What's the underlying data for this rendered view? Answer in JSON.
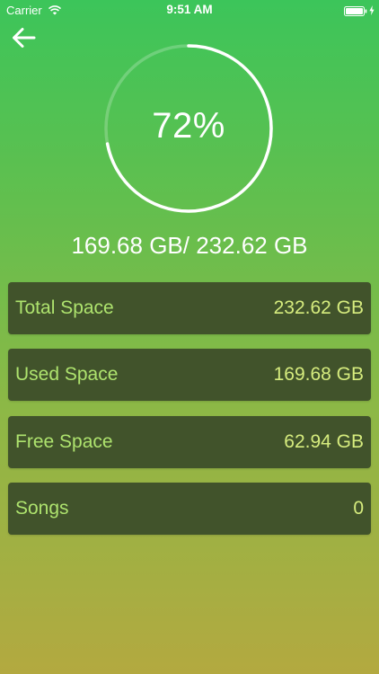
{
  "status_bar": {
    "carrier": "Carrier",
    "time": "9:51 AM",
    "wifi_icon": "wifi-icon",
    "battery_icon": "battery-icon",
    "charging_icon": "charging-bolt-icon"
  },
  "nav": {
    "back_icon": "arrow-left-icon"
  },
  "gauge": {
    "percent_label": "72%",
    "progress_fraction": 0.72
  },
  "usage_summary": "169.68 GB/ 232.62 GB",
  "stats": [
    {
      "label": "Total Space",
      "value": "232.62 GB"
    },
    {
      "label": "Used Space",
      "value": "169.68 GB"
    },
    {
      "label": "Free Space",
      "value": "62.94 GB"
    },
    {
      "label": "Songs",
      "value": "0"
    }
  ],
  "colors": {
    "gradient_top": "#3cc55a",
    "gradient_bottom": "#b3a940",
    "card_background": "#41532b",
    "label_color": "#aee36e",
    "value_color": "#d6ec7e"
  }
}
